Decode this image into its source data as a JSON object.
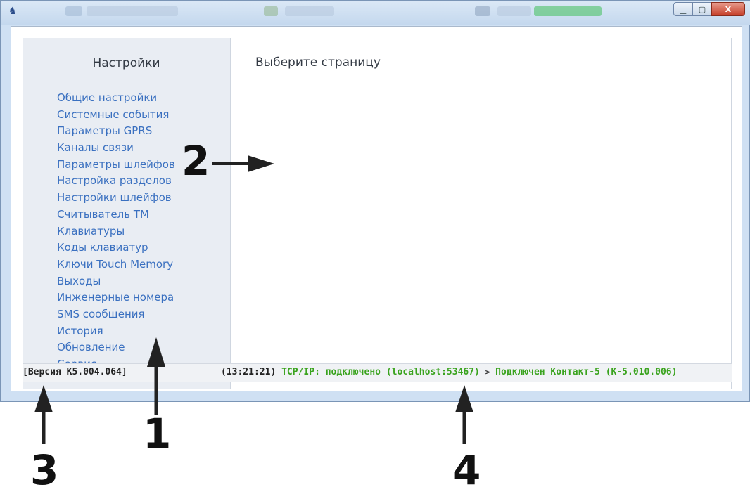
{
  "window": {
    "app_icon": "app-icon",
    "controls": {
      "minimize": "▁",
      "maximize": "▢",
      "close": "X"
    }
  },
  "sidebar": {
    "title": "Настройки",
    "items": [
      {
        "label": "Общие настройки"
      },
      {
        "label": "Системные события"
      },
      {
        "label": "Параметры GPRS"
      },
      {
        "label": "Каналы связи"
      },
      {
        "label": "Параметры шлейфов"
      },
      {
        "label": "Настройка разделов"
      },
      {
        "label": "Настройки шлейфов"
      },
      {
        "label": "Считыватель ТМ"
      },
      {
        "label": "Клавиатуры"
      },
      {
        "label": "Коды клавиатур"
      },
      {
        "label": "Ключи Touch Memory"
      },
      {
        "label": "Выходы"
      },
      {
        "label": "Инженерные номера"
      },
      {
        "label": "SMS сообщения"
      },
      {
        "label": "История"
      },
      {
        "label": "Обновление"
      },
      {
        "label": "Сервис"
      }
    ]
  },
  "main": {
    "title": "Выберите страницу"
  },
  "statusbar": {
    "version": "[Версия K5.004.064]",
    "time": "(13:21:21)",
    "connection": "TCP/IP: подключено (localhost:53467)",
    "separator": ">",
    "device": "Подключен Контакт-5 (К-5.010.006)"
  },
  "annotations": {
    "n1": "1",
    "n2": "2",
    "n3": "3",
    "n4": "4"
  },
  "colors": {
    "menu_link": "#3a70c0",
    "status_ok": "#3aa31e",
    "sidebar_bg": "#e9edf3"
  }
}
